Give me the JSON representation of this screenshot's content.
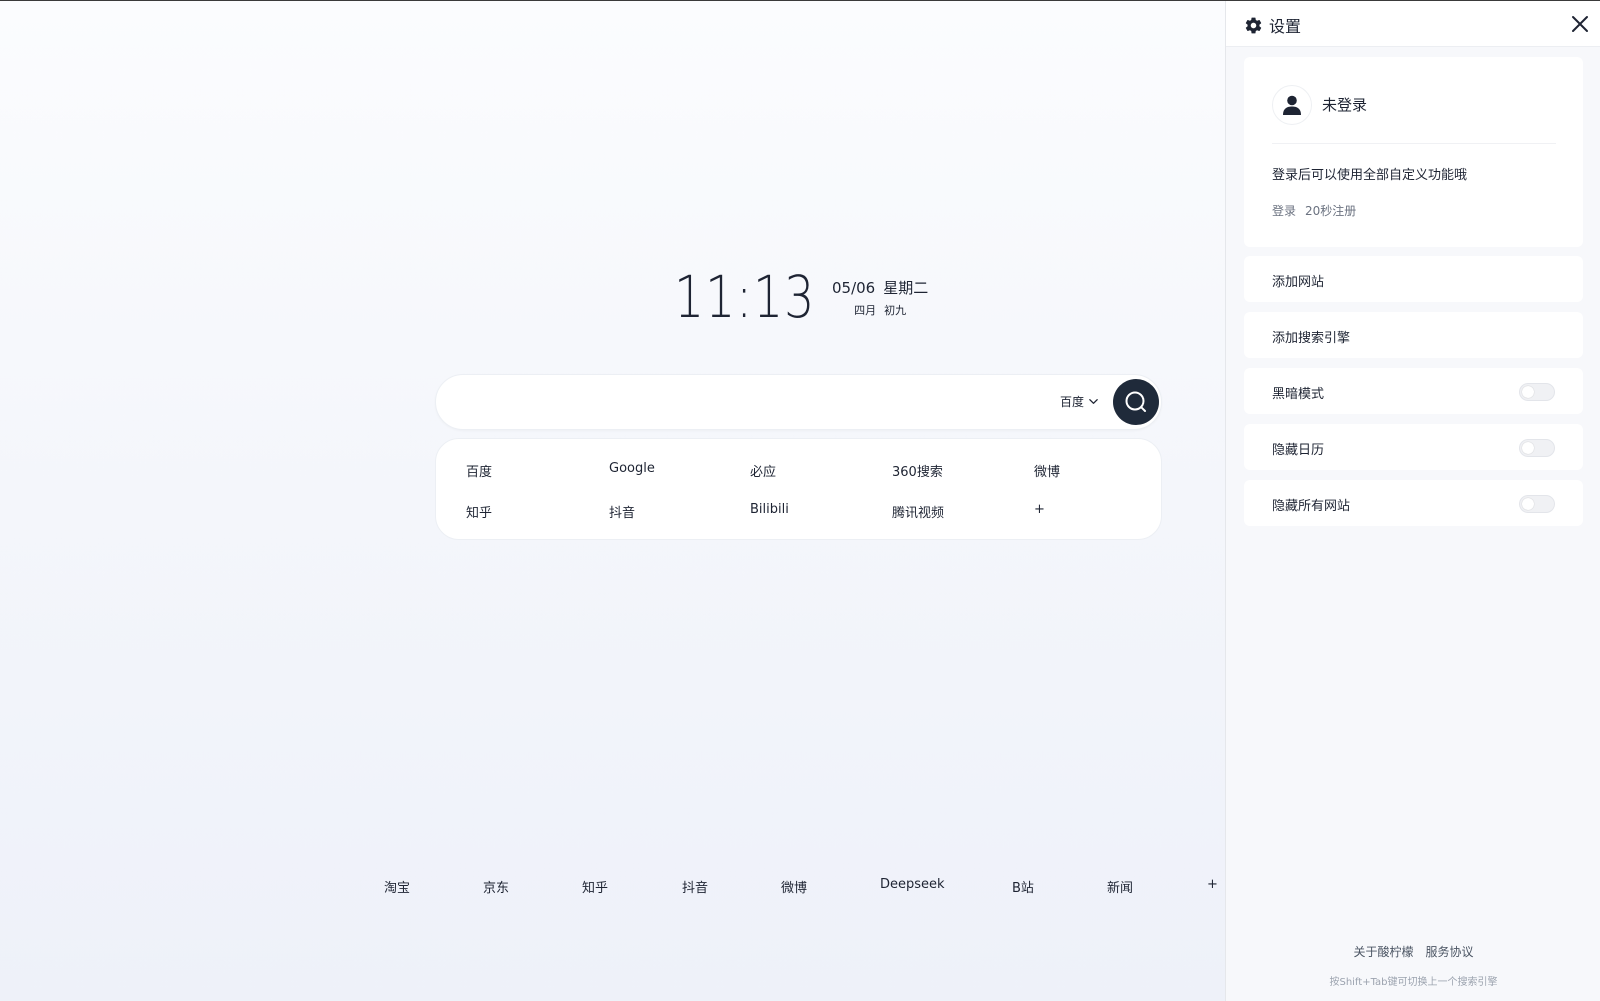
{
  "clock": {
    "time": "11:13",
    "date": "05/06",
    "weekday": "星期二",
    "lunar_month": "四月",
    "lunar_day": "初九"
  },
  "search": {
    "value": "",
    "placeholder": "",
    "engine": "百度"
  },
  "engines": [
    "百度",
    "Google",
    "必应",
    "360搜索",
    "微博",
    "知乎",
    "抖音",
    "Bilibili",
    "腾讯视频",
    "+"
  ],
  "bottom_links": [
    "淘宝",
    "京东",
    "知乎",
    "抖音",
    "微博",
    "Deepseek",
    "B站",
    "新闻",
    "+"
  ],
  "settings": {
    "title": "设置",
    "user": {
      "name": "未登录",
      "tip": "登录后可以使用全部自定义功能哦",
      "login": "登录",
      "register": "20秒注册"
    },
    "rows": {
      "add_site": "添加网站",
      "add_engine": "添加搜索引擎",
      "dark_mode": "黑暗模式",
      "hide_calendar": "隐藏日历",
      "hide_sites": "隐藏所有网站"
    },
    "toggles": {
      "dark_mode": false,
      "hide_calendar": false,
      "hide_sites": false
    },
    "footer": {
      "about": "关于酸柠檬",
      "terms": "服务协议",
      "hint": "按Shift+Tab键可切换上一个搜索引擎"
    }
  },
  "icons": {
    "settings": "gear-icon",
    "close": "close-icon",
    "avatar": "user-icon",
    "search": "search-icon",
    "dropdown": "chevron-down-icon"
  }
}
